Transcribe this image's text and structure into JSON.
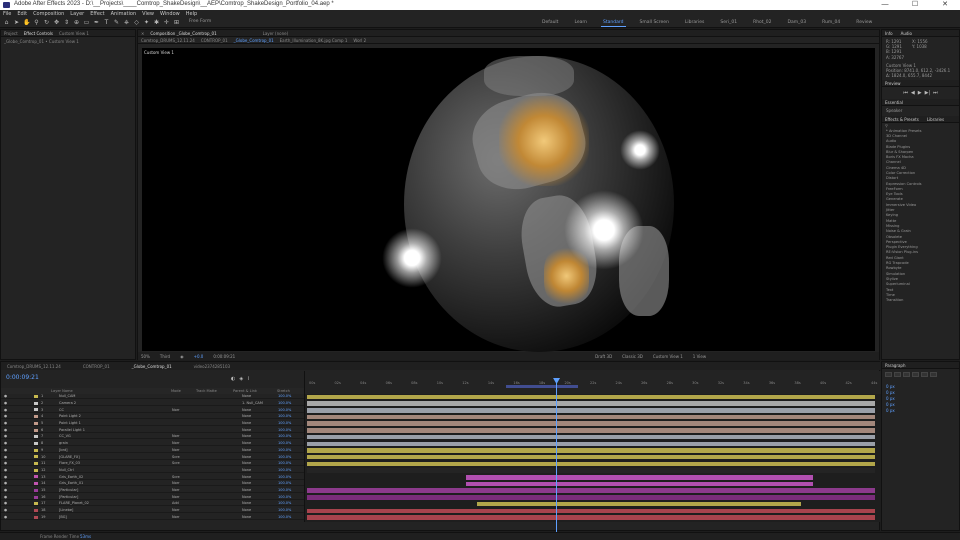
{
  "window": {
    "title": "Adobe After Effects 2023 - D:\\__Projects\\____Comtrop_ShakeDesign\\__AEP\\Comtrop_ShakeDesign_Portfolio_04.aep *",
    "minimize": "—",
    "maximize": "☐",
    "close": "✕"
  },
  "menu": [
    "File",
    "Edit",
    "Composition",
    "Layer",
    "Effect",
    "Animation",
    "View",
    "Window",
    "Help"
  ],
  "toolbar": {
    "snapping": "Free Form",
    "workspaces": [
      "Default",
      "Learn",
      "Standard",
      "Small Screen",
      "Libraries",
      "Seri_01",
      "Rhot_02",
      "Dam_03",
      "Rum_04",
      "Review"
    ],
    "active_workspace": "Standard"
  },
  "left_panel": {
    "tabs": [
      "Project",
      "Effect Controls",
      "Custom View 1"
    ],
    "subtitle": "_Globe_Comtrop_01 • Custom View 1"
  },
  "comp_panel": {
    "tab": "Composition _Globe_Comtrop_01",
    "layer_tab": "Layer (none)",
    "breadcrumbs": [
      "Comtrop_DRUMS_12.11.24",
      "CONTROP_01",
      "_Globe_Comtrop_01",
      "Earth_Illumination_8K.jpg Comp 1",
      "Worl 2"
    ],
    "view_label": "Custom View 1",
    "footer": {
      "zoom": "50%",
      "resolution": "Third",
      "timecode": "0:00:09:21",
      "renderer": "Draft 3D",
      "camera": "Classic 3D",
      "view": "Custom View 1",
      "views": "1 View",
      "exposure": "+0.0"
    }
  },
  "right_panel": {
    "tabs": [
      "Info",
      "Audio"
    ],
    "info": [
      "R: 1291",
      "G: 1291",
      "B: 1291",
      "A: 32767",
      "X: 1556",
      "Y: 1038",
      "Custom View 1",
      "Position: 8741.0, 612.2, -3426.1",
      "Δ: 1824.0, 655.7, 8442"
    ],
    "preview_title": "Preview",
    "essential_title": "Essential",
    "speaker": "Speaker",
    "effects_tabs": [
      "Effects & Presets",
      "Libraries"
    ],
    "effects": [
      "* Animation Presets",
      "3D Channel",
      "Audio",
      "Blade Plugins",
      "Blur & Sharpen",
      "Boris FX Mocha",
      "Channel",
      "Cinema 4D",
      "Color Correction",
      "Distort",
      "Expression Controls",
      "FreeForm",
      "Eye Tools",
      "Generate",
      "Immersive Video",
      "Jitter",
      "Keying",
      "Matte",
      "Missing",
      "Noise & Grain",
      "Obsolete",
      "Perspective",
      "Plugin Everything",
      "RE:Vision Plug-ins",
      "Red Giant",
      "RG Trapcode",
      "Rowbyte",
      "Simulation",
      "Stylize",
      "Superluminal",
      "Text",
      "Time",
      "Transition"
    ]
  },
  "timeline": {
    "tabs": [
      "Comtrop_DRUMS_12.11.24",
      "CONTROP_01",
      "_Globe_Comtrop_01",
      "video2374285103"
    ],
    "active_tab": "_Globe_Comtrop_01",
    "timecode": "0:00:09:21",
    "headers": {
      "layer_name": "Layer Name",
      "mode": "Mode",
      "trkmat": "Track Matte",
      "parent": "Parent & Link",
      "stretch": "Stretch"
    },
    "ruler": [
      "00s",
      "02s",
      "04s",
      "06s",
      "08s",
      "10s",
      "12s",
      "14s",
      "16s",
      "18s",
      "20s",
      "22s",
      "24s",
      "26s",
      "28s",
      "30s",
      "32s",
      "34s",
      "36s",
      "38s",
      "40s",
      "42s",
      "44s"
    ],
    "layers": [
      {
        "num": "1",
        "name": "Null_CAM",
        "color": "#c7b94f",
        "mode": "",
        "parent": "None",
        "stretch": "100.0%",
        "bar": "#b2a64a",
        "start": 0,
        "end": 1
      },
      {
        "num": "2",
        "name": "Camera 2",
        "color": "#c7c7c7",
        "mode": "",
        "parent": "1. Null_CAM",
        "stretch": "100.0%",
        "bar": "#a8a8a8",
        "start": 0,
        "end": 1
      },
      {
        "num": "3",
        "name": "CC",
        "color": "#c7c7c7",
        "mode": "Norr",
        "parent": "None",
        "stretch": "100.0%",
        "bar": "#9a9fa8",
        "start": 0,
        "end": 1
      },
      {
        "num": "4",
        "name": "Point Light 2",
        "color": "#c29a8a",
        "mode": "",
        "parent": "None",
        "stretch": "100.0%",
        "bar": "#a3877b",
        "start": 0,
        "end": 1
      },
      {
        "num": "5",
        "name": "Point Light 1",
        "color": "#c29a8a",
        "mode": "",
        "parent": "None",
        "stretch": "100.0%",
        "bar": "#a3877b",
        "start": 0,
        "end": 1
      },
      {
        "num": "6",
        "name": "Parallel Light 1",
        "color": "#c29a8a",
        "mode": "",
        "parent": "None",
        "stretch": "100.0%",
        "bar": "#a3877b",
        "start": 0,
        "end": 1
      },
      {
        "num": "7",
        "name": "CC_VG",
        "color": "#c7c7c7",
        "mode": "Norr",
        "parent": "None",
        "stretch": "100.0%",
        "bar": "#9a9fa8",
        "start": 0,
        "end": 1
      },
      {
        "num": "8",
        "name": "grain",
        "color": "#c7c7c7",
        "mode": "Norr",
        "parent": "None",
        "stretch": "100.0%",
        "bar": "#9a9fa8",
        "start": 0,
        "end": 1
      },
      {
        "num": "9",
        "name": "[bnt]",
        "color": "#c7b94f",
        "mode": "Norr",
        "parent": "None",
        "stretch": "100.0%",
        "bar": "#b2a64a",
        "start": 0,
        "end": 1
      },
      {
        "num": "10",
        "name": "[GLARE_FX]",
        "color": "#c7b94f",
        "mode": "Scre",
        "parent": "None",
        "stretch": "100.0%",
        "bar": "#b2a64a",
        "start": 0,
        "end": 1
      },
      {
        "num": "11",
        "name": "Flare_FX_03",
        "color": "#c7b94f",
        "mode": "Scre",
        "parent": "None",
        "stretch": "100.0%",
        "bar": "#b2a64a",
        "start": 0,
        "end": 1
      },
      {
        "num": "12",
        "name": "Null_Ctrl",
        "color": "#c7b94f",
        "mode": "",
        "parent": "None",
        "stretch": "100.0%",
        "bar": "#242424",
        "start": 0,
        "end": 1
      },
      {
        "num": "13",
        "name": "Gris_Earth_02",
        "color": "#c054b0",
        "mode": "Scre",
        "parent": "None",
        "stretch": "100.0%",
        "bar": "#b14fb0",
        "start": 0.28,
        "end": 0.89
      },
      {
        "num": "14",
        "name": "Gris_Earth_01",
        "color": "#c054b0",
        "mode": "Norr",
        "parent": "None",
        "stretch": "100.0%",
        "bar": "#b14fb0",
        "start": 0.28,
        "end": 0.89
      },
      {
        "num": "15",
        "name": "[Particular]",
        "color": "#9b3c9b",
        "mode": "Norr",
        "parent": "None",
        "stretch": "100.0%",
        "bar": "#8c3a8c",
        "start": 0,
        "end": 1
      },
      {
        "num": "16",
        "name": "[Particular]",
        "color": "#9b3c9b",
        "mode": "Norr",
        "parent": "None",
        "stretch": "100.0%",
        "bar": "#7a2d7a",
        "start": 0,
        "end": 1
      },
      {
        "num": "17",
        "name": "FLARE_Planet_02",
        "color": "#c7b94f",
        "mode": "Add",
        "parent": "None",
        "stretch": "100.0%",
        "bar": "#b2a64a",
        "start": 0.3,
        "end": 0.87
      },
      {
        "num": "18",
        "name": "[Linebe]",
        "color": "#b04a55",
        "mode": "Norr",
        "parent": "None",
        "stretch": "100.0%",
        "bar": "#a8434d",
        "start": 0,
        "end": 1
      },
      {
        "num": "19",
        "name": "[BG]",
        "color": "#b04a55",
        "mode": "Norr",
        "parent": "None",
        "stretch": "100.0%",
        "bar": "#a8434d",
        "start": 0,
        "end": 1
      }
    ],
    "playhead_fraction": 0.442
  },
  "paragraph_panel": {
    "title": "Paragraph",
    "fields": [
      "0 px",
      "0 px",
      "0 px",
      "0 px",
      "0 px"
    ]
  },
  "status": {
    "frame_render_label": "Frame Render Time",
    "frame_render_value": "53ms"
  }
}
